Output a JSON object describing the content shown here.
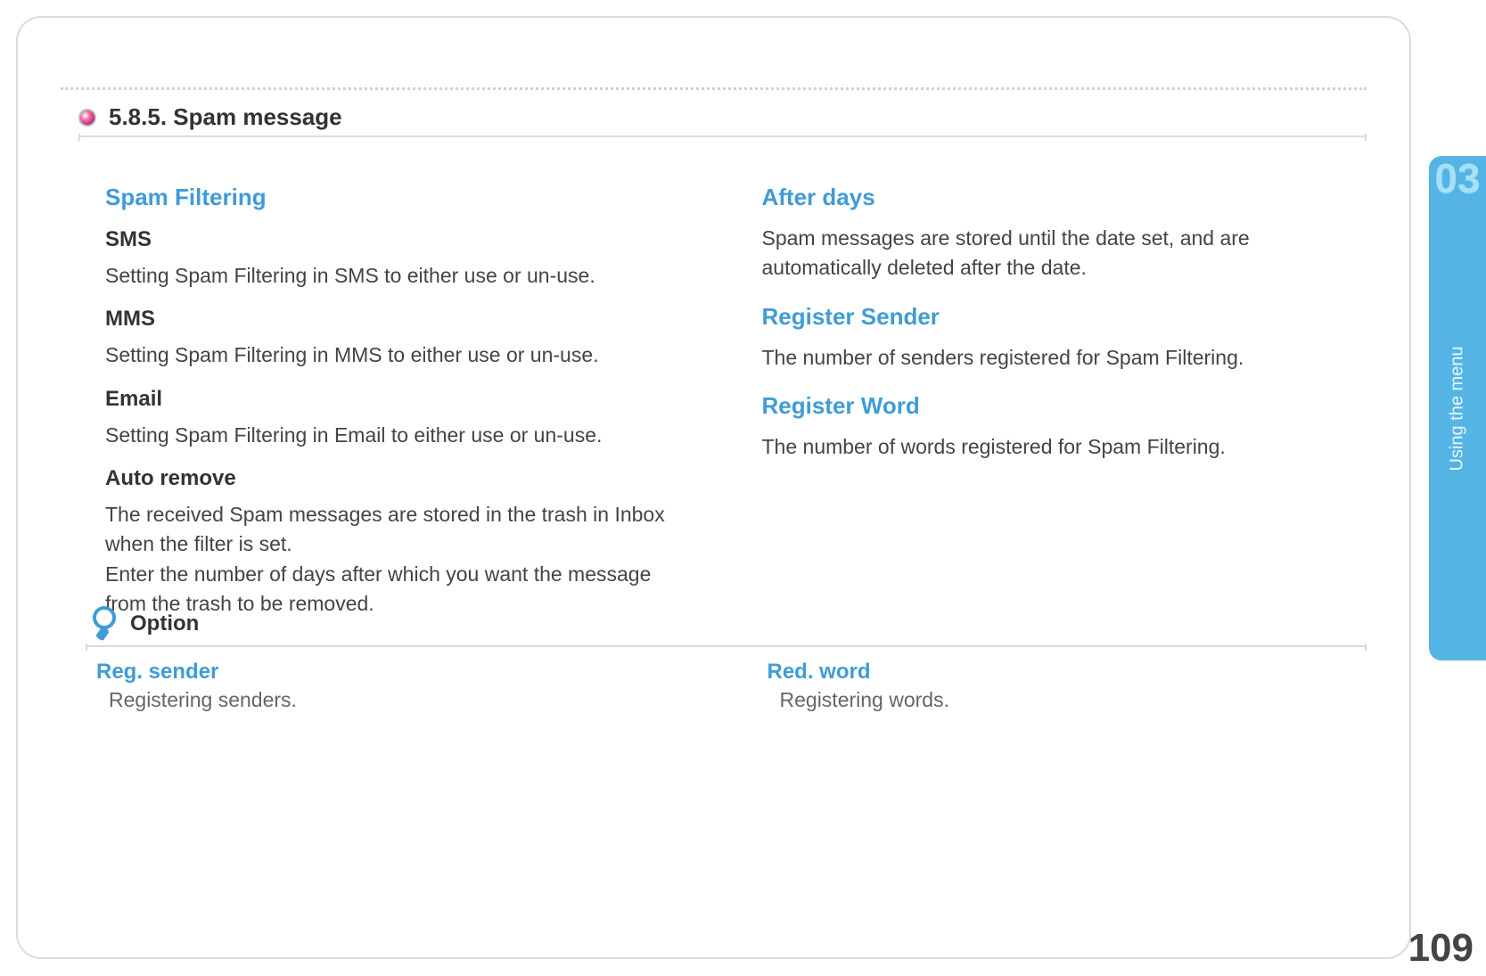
{
  "section": {
    "number": "5.8.5.",
    "title": "Spam message"
  },
  "left": {
    "h1": "Spam Filtering",
    "sms_h": "SMS",
    "sms_b": "Setting Spam Filtering in SMS to either use or un-use.",
    "mms_h": "MMS",
    "mms_b": "Setting Spam Filtering in MMS to either use or un-use.",
    "email_h": "Email",
    "email_b": "Setting Spam Filtering in Email to either use or un-use.",
    "auto_h": "Auto remove",
    "auto_b1": "The received Spam messages are stored in the trash in Inbox when the filter is set.",
    "auto_b2": "Enter the number of days after which you want the message from the trash to be removed."
  },
  "right": {
    "after_h": "After days",
    "after_b": "Spam messages are stored until the date set, and are automatically deleted after the date.",
    "regsender_h": "Register Sender",
    "regsender_b": "The number of senders registered for Spam Filtering.",
    "regword_h": "Register Word",
    "regword_b": "The number of words registered for Spam Filtering."
  },
  "option": {
    "title": "Option",
    "col1_h": "Reg. sender",
    "col1_b": "Registering senders.",
    "col2_h": "Red. word",
    "col2_b": "Registering words."
  },
  "tab": {
    "number": "03",
    "label": "Using the menu"
  },
  "page_number": "109"
}
